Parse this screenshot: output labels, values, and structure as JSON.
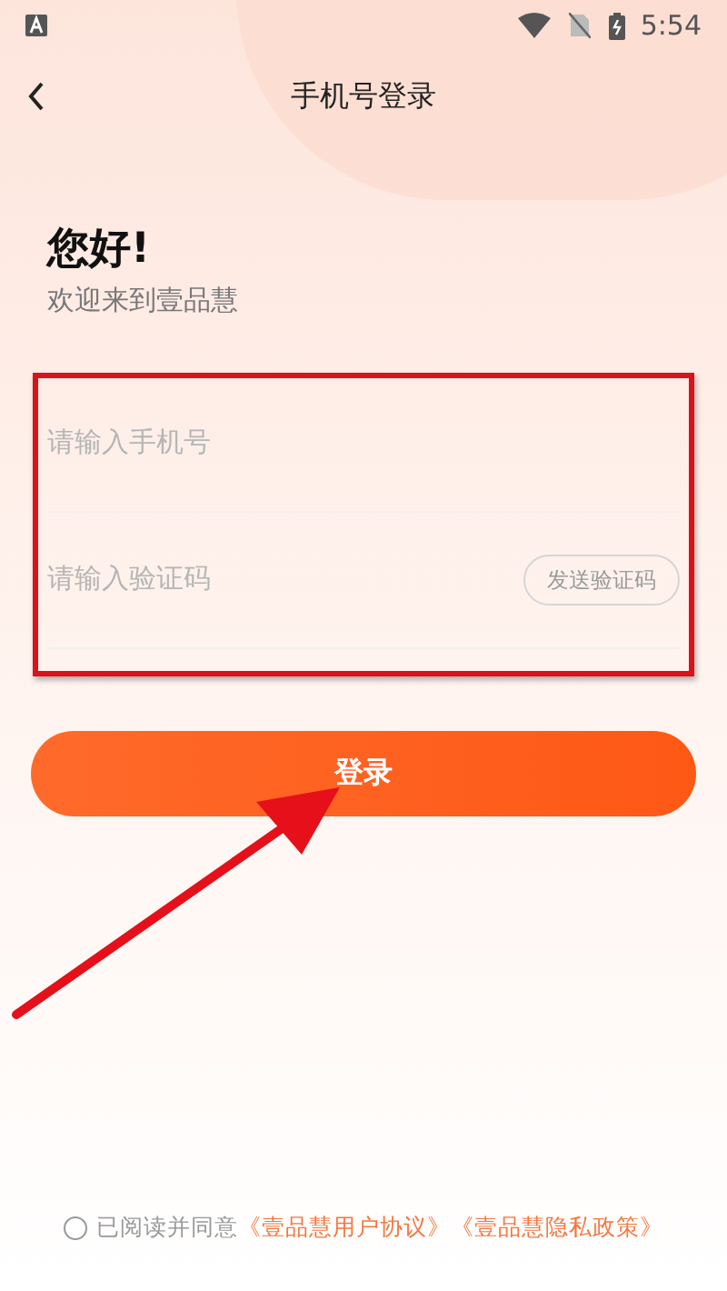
{
  "status_bar": {
    "time": "5:54"
  },
  "header": {
    "title": "手机号登录"
  },
  "greeting": {
    "title": "您好!",
    "subtitle": "欢迎来到壹品慧"
  },
  "fields": [
    {
      "placeholder": "请输入手机号"
    },
    {
      "placeholder": "请输入验证码",
      "action": "发送验证码"
    }
  ],
  "login_button": "登录",
  "agreement": {
    "checked": false,
    "text": "已阅读并同意",
    "links": [
      "《壹品慧用户协议》",
      "《壹品慧隐私政策》"
    ]
  }
}
